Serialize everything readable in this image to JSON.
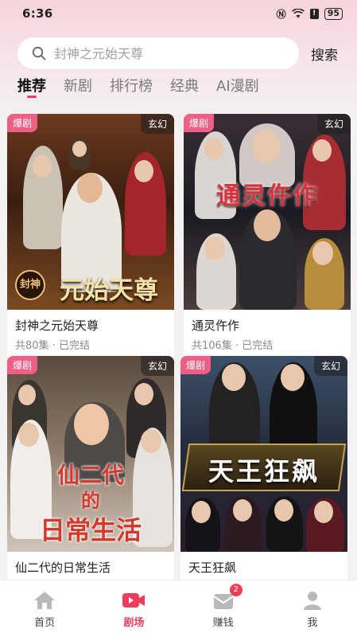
{
  "status_bar": {
    "time": "6:36",
    "battery": "95"
  },
  "search": {
    "placeholder": "封神之元始天尊",
    "button_label": "搜索"
  },
  "tabs": [
    {
      "label": "推荐",
      "active": true
    },
    {
      "label": "新剧",
      "active": false
    },
    {
      "label": "排行榜",
      "active": false
    },
    {
      "label": "经典",
      "active": false
    },
    {
      "label": "AI漫剧",
      "active": false
    }
  ],
  "dramas": [
    {
      "hot_badge": "爆剧",
      "genre": "玄幻",
      "poster_text": "元始天尊",
      "poster_seal": "封神",
      "title": "封神之元始天尊",
      "meta": "共80集 · 已完结"
    },
    {
      "hot_badge": "爆剧",
      "genre": "玄幻",
      "poster_text": "通灵仵作",
      "title": "通灵仵作",
      "meta": "共106集 · 已完结"
    },
    {
      "hot_badge": "爆剧",
      "genre": "玄幻",
      "poster_text_1": "仙二代",
      "poster_text_2": "的",
      "poster_text_3": "日常生活",
      "title": "仙二代的日常生活",
      "meta": ""
    },
    {
      "hot_badge": "爆剧",
      "genre": "玄幻",
      "poster_text": "天王狂飙",
      "title": "天王狂飙",
      "meta": ""
    }
  ],
  "nav": [
    {
      "label": "首页",
      "icon": "home-icon",
      "active": false
    },
    {
      "label": "剧场",
      "icon": "video-icon",
      "active": true
    },
    {
      "label": "赚钱",
      "icon": "envelope-icon",
      "active": false,
      "badge": "2"
    },
    {
      "label": "我",
      "icon": "user-icon",
      "active": false
    }
  ],
  "colors": {
    "accent": "#e8405f",
    "hot_badge": "#ee5f86"
  }
}
